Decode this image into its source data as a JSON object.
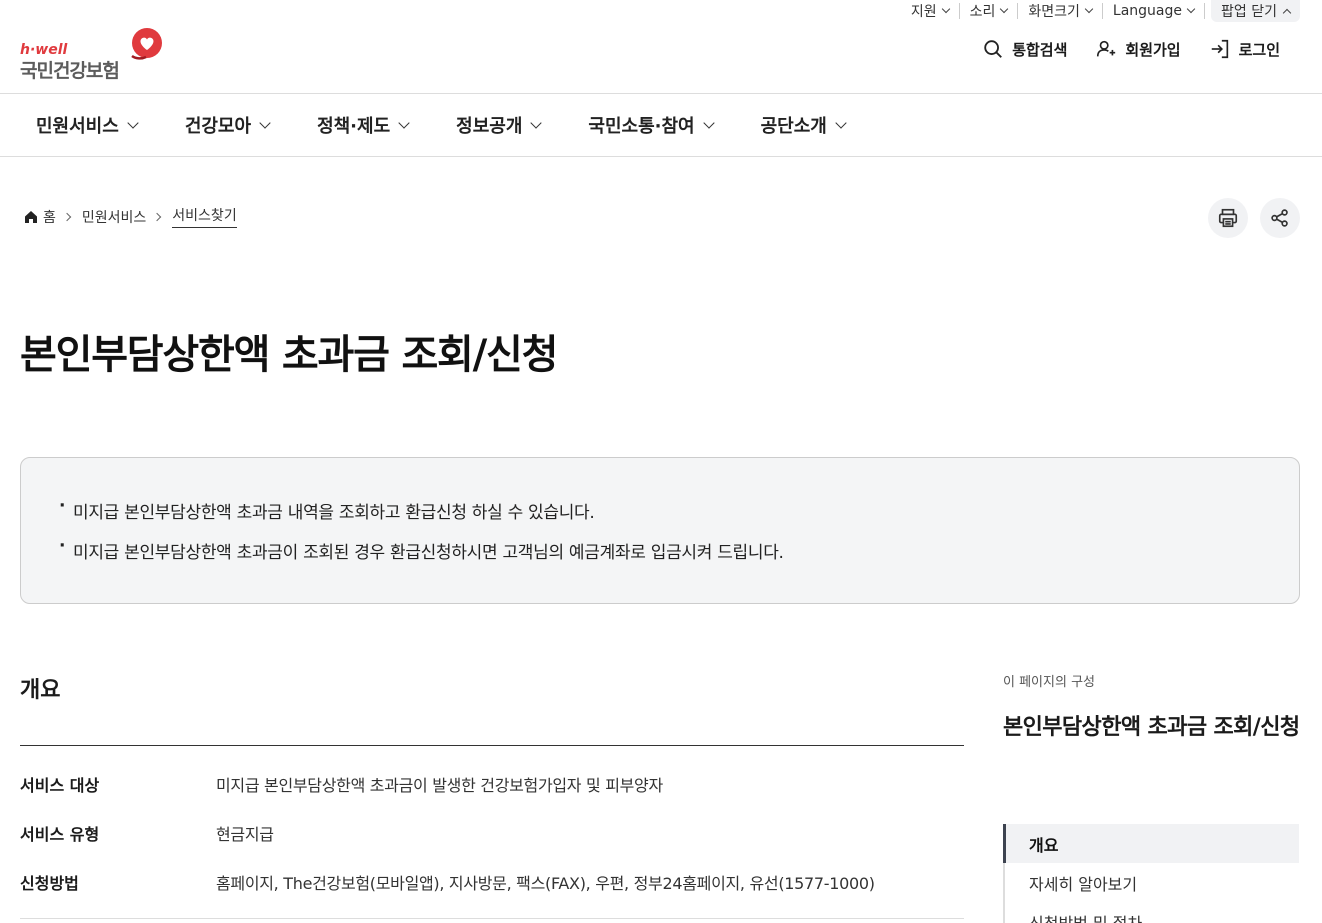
{
  "util": {
    "items": [
      "지원",
      "소리",
      "화면크기",
      "Language"
    ],
    "popup_close": "팝업 닫기"
  },
  "logo": {
    "brand": "h·well",
    "name": "국민건강보험"
  },
  "header": {
    "search": "통합검색",
    "signup": "회원가입",
    "login": "로그인"
  },
  "gnb": [
    "민원서비스",
    "건강모아",
    "정책·제도",
    "정보공개",
    "국민소통·참여",
    "공단소개"
  ],
  "breadcrumb": {
    "home": "홈",
    "level1": "민원서비스",
    "current": "서비스찾기"
  },
  "page": {
    "title": "본인부담상한액 초과금 조회/신청",
    "intro": [
      "미지급 본인부담상한액 초과금 내역을 조회하고 환급신청 하실 수 있습니다.",
      "미지급 본인부담상한액 초과금이 조회된 경우 환급신청하시면 고객님의 예금계좌로 입금시켜 드립니다."
    ]
  },
  "overview": {
    "heading": "개요",
    "rows": [
      {
        "key": "서비스 대상",
        "value": "미지급 본인부담상한액 초과금이 발생한 건강보험가입자 및 피부양자"
      },
      {
        "key": "서비스 유형",
        "value": "현금지급"
      },
      {
        "key": "신청방법",
        "value": "홈페이지, The건강보험(모바일앱), 지사방문, 팩스(FAX), 우편, 정부24홈페이지, 유선(1577-1000)"
      }
    ]
  },
  "toc": {
    "caption": "이 페이지의 구성",
    "title": "본인부담상한액 초과금 조회/신청",
    "items": [
      "개요",
      "자세히 알아보기",
      "신청방법 및 절차"
    ]
  },
  "colors": {
    "brand_red": "#e03a3e",
    "toc_active": "#3d4350"
  },
  "icons": [
    "search-icon",
    "user-plus-icon",
    "login-icon",
    "home-icon",
    "print-icon",
    "share-icon",
    "heart-logo-icon"
  ]
}
